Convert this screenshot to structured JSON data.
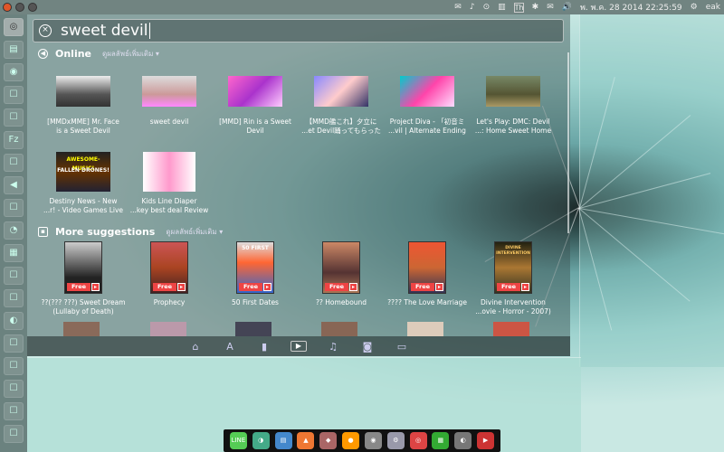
{
  "top_panel": {
    "indicators": [
      "✉",
      "♪",
      "⊙",
      "▥",
      "Th",
      "✱",
      "✉",
      "🔊"
    ],
    "datetime": "พ. พ.ค. 28 2014 22:25:59",
    "username": "eak"
  },
  "launcher": {
    "items": [
      {
        "name": "dash-home",
        "glyph": "◎"
      },
      {
        "name": "files",
        "glyph": "▤"
      },
      {
        "name": "browser",
        "glyph": "◉"
      },
      {
        "name": "app-3",
        "glyph": "☐"
      },
      {
        "name": "app-4",
        "glyph": "☐"
      },
      {
        "name": "filezilla",
        "glyph": "Fz"
      },
      {
        "name": "app-6",
        "glyph": "☐"
      },
      {
        "name": "app-7",
        "glyph": "◀"
      },
      {
        "name": "app-8",
        "glyph": "☐"
      },
      {
        "name": "app-9",
        "glyph": "◔"
      },
      {
        "name": "app-10",
        "glyph": "▦"
      },
      {
        "name": "app-11",
        "glyph": "☐"
      },
      {
        "name": "app-12",
        "glyph": "☐"
      },
      {
        "name": "app-13",
        "glyph": "◐"
      },
      {
        "name": "app-14",
        "glyph": "☐"
      },
      {
        "name": "app-15",
        "glyph": "☐"
      },
      {
        "name": "app-16",
        "glyph": "☐"
      },
      {
        "name": "app-17",
        "glyph": "☐"
      },
      {
        "name": "app-18",
        "glyph": "☐"
      }
    ]
  },
  "search": {
    "query": "sweet devil"
  },
  "online": {
    "title": "Online",
    "filter": "ดูผลลัพธ์เพิ่มเติม ▾",
    "items": [
      {
        "line1": "[MMDxMME] Mr. Face",
        "line2": "is a Sweet Devil"
      },
      {
        "line1": "sweet devil",
        "line2": ""
      },
      {
        "line1": "[MMD] Rin is a Sweet",
        "line2": "Devil"
      },
      {
        "line1": "【MMD艦これ】夕立に",
        "line2": "...et Devil踊ってもらった"
      },
      {
        "line1": "Project Diva - 「初音ミ",
        "line2": "...vil | Alternate Ending"
      },
      {
        "line1": "Let's Play: DMC: Devil",
        "line2": "...: Home Sweet Home"
      },
      {
        "line1": "Destiny News - New",
        "line2": "...r! - Video Games Live"
      },
      {
        "line1": "Kids Line Diaper",
        "line2": "...key best deal Review"
      }
    ],
    "thumb_texts": [
      "AWESOME-MUSIC!",
      "FALLEN DRONES!"
    ]
  },
  "more": {
    "title": "More suggestions",
    "filter": "ดูผลลัพธ์เพิ่มเติม ▾",
    "badge": "Free",
    "items": [
      {
        "line1": "??(??? ???) Sweet Dream",
        "line2": "(Lullaby of Death)"
      },
      {
        "line1": "Prophecy",
        "line2": ""
      },
      {
        "line1": "50 First Dates",
        "line2": ""
      },
      {
        "line1": "?? Homebound",
        "line2": ""
      },
      {
        "line1": "???? The Love Marriage",
        "line2": ""
      },
      {
        "line1": "Divine Intervention",
        "line2": "...ovie - Horror - 2007)"
      }
    ],
    "poster_texts": [
      "50 FIRST",
      "DIVINE INTERVENTION"
    ]
  },
  "lenses": [
    "⌂",
    "A",
    "▮",
    "▶",
    "♫",
    "◙",
    "▭"
  ],
  "dock": {
    "items": [
      {
        "label": "LINE",
        "color": "#5c5"
      },
      {
        "label": "◑",
        "color": "#4a8"
      },
      {
        "label": "▤",
        "color": "#48c"
      },
      {
        "label": "▲",
        "color": "#e73"
      },
      {
        "label": "◆",
        "color": "#a66"
      },
      {
        "label": "●",
        "color": "#f90"
      },
      {
        "label": "◉",
        "color": "#888"
      },
      {
        "label": "⚙",
        "color": "#99a"
      },
      {
        "label": "◎",
        "color": "#d44"
      },
      {
        "label": "▦",
        "color": "#3a3"
      },
      {
        "label": "◐",
        "color": "#777"
      },
      {
        "label": "▶",
        "color": "#c33"
      }
    ]
  }
}
